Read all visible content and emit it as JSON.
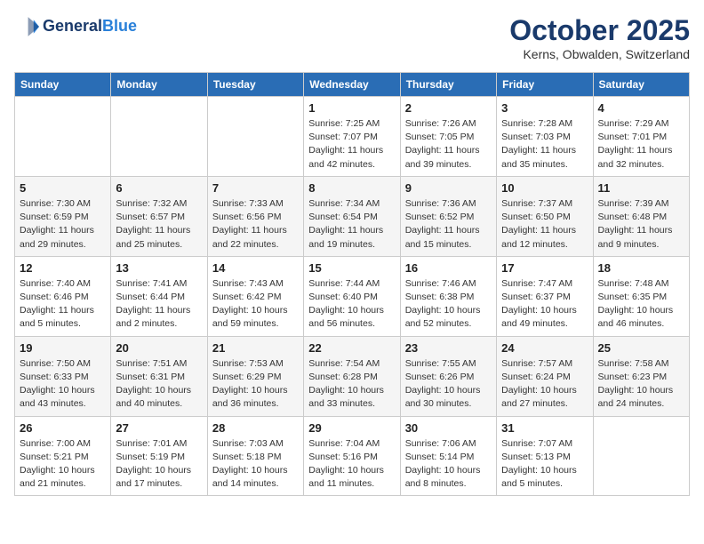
{
  "header": {
    "logo_line1": "General",
    "logo_line2": "Blue",
    "month": "October 2025",
    "location": "Kerns, Obwalden, Switzerland"
  },
  "days_of_week": [
    "Sunday",
    "Monday",
    "Tuesday",
    "Wednesday",
    "Thursday",
    "Friday",
    "Saturday"
  ],
  "weeks": [
    [
      {
        "day": "",
        "info": ""
      },
      {
        "day": "",
        "info": ""
      },
      {
        "day": "",
        "info": ""
      },
      {
        "day": "1",
        "info": "Sunrise: 7:25 AM\nSunset: 7:07 PM\nDaylight: 11 hours and 42 minutes."
      },
      {
        "day": "2",
        "info": "Sunrise: 7:26 AM\nSunset: 7:05 PM\nDaylight: 11 hours and 39 minutes."
      },
      {
        "day": "3",
        "info": "Sunrise: 7:28 AM\nSunset: 7:03 PM\nDaylight: 11 hours and 35 minutes."
      },
      {
        "day": "4",
        "info": "Sunrise: 7:29 AM\nSunset: 7:01 PM\nDaylight: 11 hours and 32 minutes."
      }
    ],
    [
      {
        "day": "5",
        "info": "Sunrise: 7:30 AM\nSunset: 6:59 PM\nDaylight: 11 hours and 29 minutes."
      },
      {
        "day": "6",
        "info": "Sunrise: 7:32 AM\nSunset: 6:57 PM\nDaylight: 11 hours and 25 minutes."
      },
      {
        "day": "7",
        "info": "Sunrise: 7:33 AM\nSunset: 6:56 PM\nDaylight: 11 hours and 22 minutes."
      },
      {
        "day": "8",
        "info": "Sunrise: 7:34 AM\nSunset: 6:54 PM\nDaylight: 11 hours and 19 minutes."
      },
      {
        "day": "9",
        "info": "Sunrise: 7:36 AM\nSunset: 6:52 PM\nDaylight: 11 hours and 15 minutes."
      },
      {
        "day": "10",
        "info": "Sunrise: 7:37 AM\nSunset: 6:50 PM\nDaylight: 11 hours and 12 minutes."
      },
      {
        "day": "11",
        "info": "Sunrise: 7:39 AM\nSunset: 6:48 PM\nDaylight: 11 hours and 9 minutes."
      }
    ],
    [
      {
        "day": "12",
        "info": "Sunrise: 7:40 AM\nSunset: 6:46 PM\nDaylight: 11 hours and 5 minutes."
      },
      {
        "day": "13",
        "info": "Sunrise: 7:41 AM\nSunset: 6:44 PM\nDaylight: 11 hours and 2 minutes."
      },
      {
        "day": "14",
        "info": "Sunrise: 7:43 AM\nSunset: 6:42 PM\nDaylight: 10 hours and 59 minutes."
      },
      {
        "day": "15",
        "info": "Sunrise: 7:44 AM\nSunset: 6:40 PM\nDaylight: 10 hours and 56 minutes."
      },
      {
        "day": "16",
        "info": "Sunrise: 7:46 AM\nSunset: 6:38 PM\nDaylight: 10 hours and 52 minutes."
      },
      {
        "day": "17",
        "info": "Sunrise: 7:47 AM\nSunset: 6:37 PM\nDaylight: 10 hours and 49 minutes."
      },
      {
        "day": "18",
        "info": "Sunrise: 7:48 AM\nSunset: 6:35 PM\nDaylight: 10 hours and 46 minutes."
      }
    ],
    [
      {
        "day": "19",
        "info": "Sunrise: 7:50 AM\nSunset: 6:33 PM\nDaylight: 10 hours and 43 minutes."
      },
      {
        "day": "20",
        "info": "Sunrise: 7:51 AM\nSunset: 6:31 PM\nDaylight: 10 hours and 40 minutes."
      },
      {
        "day": "21",
        "info": "Sunrise: 7:53 AM\nSunset: 6:29 PM\nDaylight: 10 hours and 36 minutes."
      },
      {
        "day": "22",
        "info": "Sunrise: 7:54 AM\nSunset: 6:28 PM\nDaylight: 10 hours and 33 minutes."
      },
      {
        "day": "23",
        "info": "Sunrise: 7:55 AM\nSunset: 6:26 PM\nDaylight: 10 hours and 30 minutes."
      },
      {
        "day": "24",
        "info": "Sunrise: 7:57 AM\nSunset: 6:24 PM\nDaylight: 10 hours and 27 minutes."
      },
      {
        "day": "25",
        "info": "Sunrise: 7:58 AM\nSunset: 6:23 PM\nDaylight: 10 hours and 24 minutes."
      }
    ],
    [
      {
        "day": "26",
        "info": "Sunrise: 7:00 AM\nSunset: 5:21 PM\nDaylight: 10 hours and 21 minutes."
      },
      {
        "day": "27",
        "info": "Sunrise: 7:01 AM\nSunset: 5:19 PM\nDaylight: 10 hours and 17 minutes."
      },
      {
        "day": "28",
        "info": "Sunrise: 7:03 AM\nSunset: 5:18 PM\nDaylight: 10 hours and 14 minutes."
      },
      {
        "day": "29",
        "info": "Sunrise: 7:04 AM\nSunset: 5:16 PM\nDaylight: 10 hours and 11 minutes."
      },
      {
        "day": "30",
        "info": "Sunrise: 7:06 AM\nSunset: 5:14 PM\nDaylight: 10 hours and 8 minutes."
      },
      {
        "day": "31",
        "info": "Sunrise: 7:07 AM\nSunset: 5:13 PM\nDaylight: 10 hours and 5 minutes."
      },
      {
        "day": "",
        "info": ""
      }
    ]
  ]
}
